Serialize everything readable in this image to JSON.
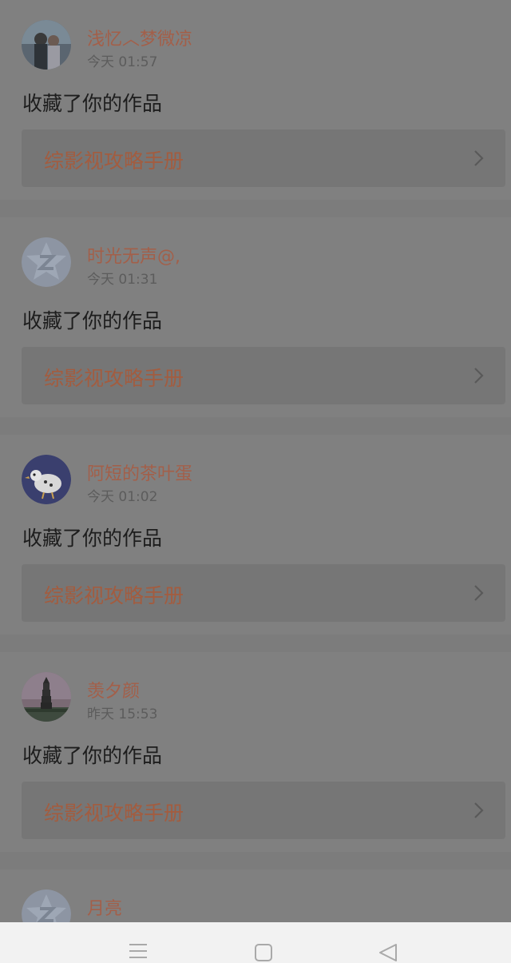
{
  "notifications": [
    {
      "username": "浅忆︿梦微凉",
      "time": "今天 01:57",
      "action": "收藏了你的作品",
      "work_title": "综影视攻略手册",
      "avatar": "photo-couple"
    },
    {
      "username": "时光无声@,",
      "time": "今天 01:31",
      "action": "收藏了你的作品",
      "work_title": "综影视攻略手册",
      "avatar": "default-avatar"
    },
    {
      "username": "阿短的茶叶蛋",
      "time": "今天 01:02",
      "action": "收藏了你的作品",
      "work_title": "综影视攻略手册",
      "avatar": "cartoon-bird"
    },
    {
      "username": "羡夕颜",
      "time": "昨天 15:53",
      "action": "收藏了你的作品",
      "work_title": "综影视攻略手册",
      "avatar": "pagoda-photo"
    },
    {
      "username": "月亮",
      "time": "",
      "action": "",
      "work_title": "",
      "avatar": "default-avatar"
    }
  ],
  "navbar": {
    "icons": [
      "menu-icon",
      "home-square-icon",
      "back-triangle-icon"
    ]
  },
  "colors": {
    "background": "#7c7c7c",
    "accent": "#a35f49",
    "navbar": "#f2f2f2"
  }
}
